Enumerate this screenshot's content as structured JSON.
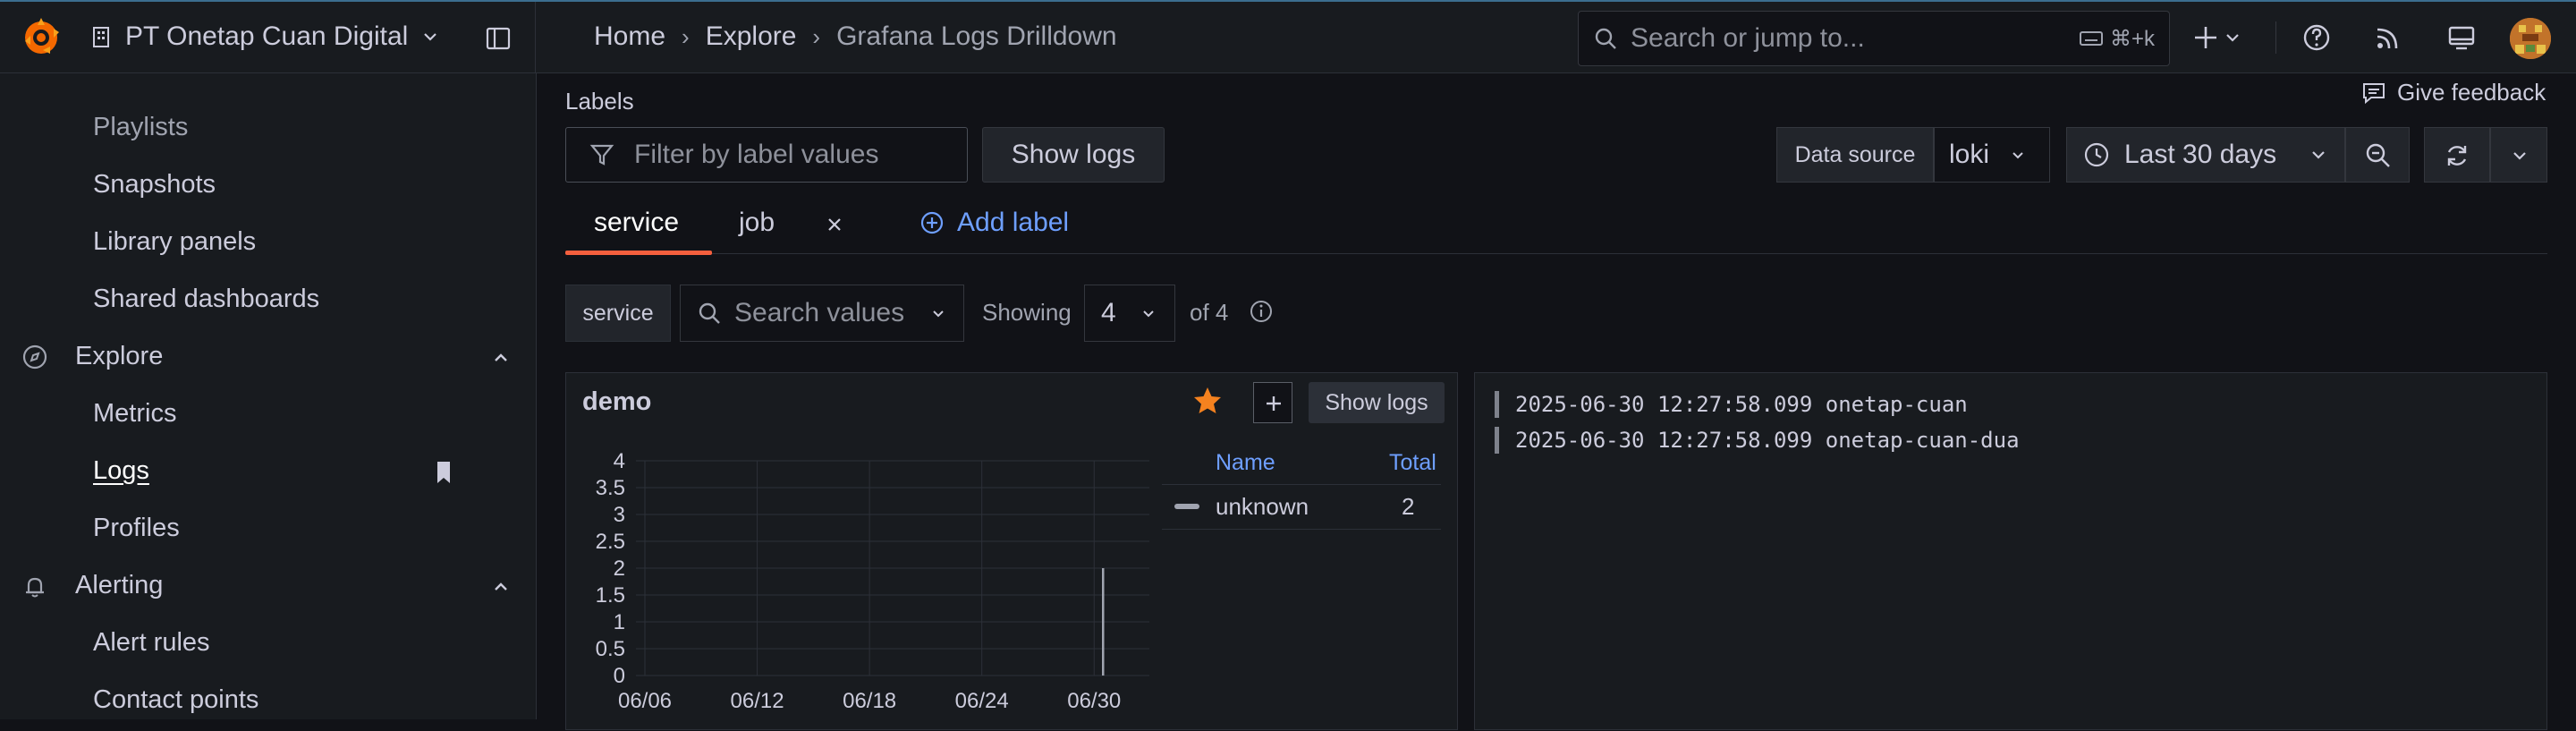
{
  "org": {
    "name": "PT Onetap Cuan Digital"
  },
  "breadcrumbs": [
    "Home",
    "Explore",
    "Grafana Logs Drilldown"
  ],
  "search": {
    "placeholder": "Search or jump to...",
    "shortcut": "⌘+k"
  },
  "sidebar": {
    "items": [
      {
        "label": "Playlists"
      },
      {
        "label": "Snapshots"
      },
      {
        "label": "Library panels"
      },
      {
        "label": "Shared dashboards"
      },
      {
        "label": "Explore",
        "type": "section",
        "icon": "compass-icon"
      },
      {
        "label": "Metrics"
      },
      {
        "label": "Logs",
        "active": true,
        "bookmarked": true
      },
      {
        "label": "Profiles"
      },
      {
        "label": "Alerting",
        "type": "section",
        "icon": "bell-icon"
      },
      {
        "label": "Alert rules"
      },
      {
        "label": "Contact points"
      }
    ]
  },
  "toolbar": {
    "labels_title": "Labels",
    "give_feedback": "Give feedback",
    "filter_placeholder": "Filter by label values",
    "show_logs": "Show logs",
    "data_source_label": "Data source",
    "data_source_value": "loki",
    "time_range": "Last 30 days"
  },
  "tabs": [
    {
      "label": "service",
      "active": true
    },
    {
      "label": "job",
      "closable": true
    }
  ],
  "add_label": "Add label",
  "filters": {
    "service_tag": "service",
    "search_placeholder": "Search values",
    "showing_label": "Showing",
    "showing_value": "4",
    "of_label": "of 4"
  },
  "panel": {
    "title": "demo",
    "show_logs": "Show logs",
    "legend": {
      "name_header": "Name",
      "total_header": "Total",
      "rows": [
        {
          "name": "unknown",
          "total": "2"
        }
      ]
    }
  },
  "chart_data": {
    "type": "bar",
    "title": "demo",
    "x": [
      "06/06",
      "06/12",
      "06/18",
      "06/24",
      "06/30"
    ],
    "xlabel": "",
    "ylabel": "",
    "y_ticks": [
      "0",
      "0.5",
      "1",
      "1.5",
      "2",
      "2.5",
      "3",
      "3.5",
      "4"
    ],
    "ylim": [
      0,
      4
    ],
    "grid": true,
    "series": [
      {
        "name": "unknown",
        "points": [
          {
            "x": "06/30",
            "y": 2
          }
        ]
      }
    ]
  },
  "logs": [
    "2025-06-30 12:27:58.099 onetap-cuan",
    "2025-06-30 12:27:58.099 onetap-cuan-dua"
  ]
}
